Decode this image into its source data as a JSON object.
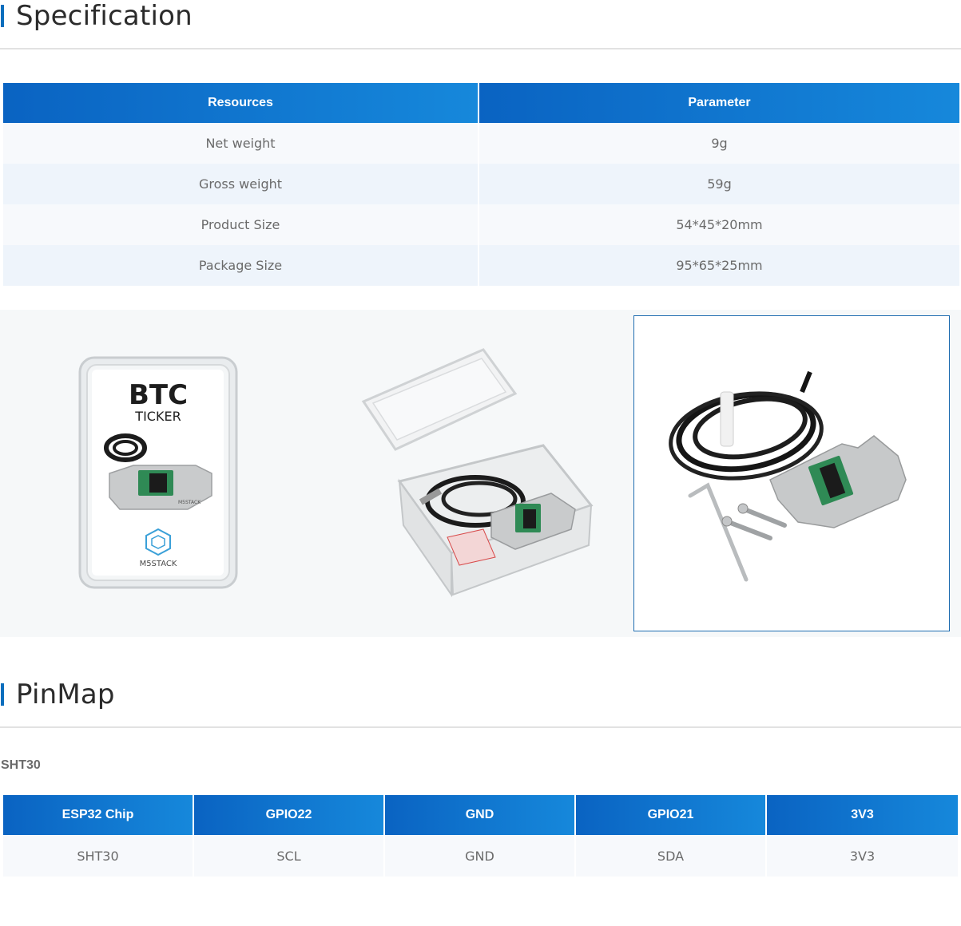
{
  "spec": {
    "title": "Specification",
    "headers": [
      "Resources",
      "Parameter"
    ],
    "rows": [
      {
        "resource": "Net weight",
        "parameter": "9g"
      },
      {
        "resource": "Gross weight",
        "parameter": "59g"
      },
      {
        "resource": "Product Size",
        "parameter": "54*45*20mm"
      },
      {
        "resource": "Package Size",
        "parameter": "95*65*25mm"
      }
    ]
  },
  "gallery": {
    "box_card": {
      "title": "BTC",
      "subtitle": "TICKER",
      "brand": "M5STACK",
      "stand_text": "M5STACK"
    }
  },
  "pinmap": {
    "title": "PinMap",
    "subtitle": "SHT30",
    "headers": [
      "ESP32 Chip",
      "GPIO22",
      "GND",
      "GPIO21",
      "3V3"
    ],
    "row": [
      "SHT30",
      "SCL",
      "GND",
      "SDA",
      "3V3"
    ]
  },
  "colors": {
    "accent": "#0a6ebd",
    "header_start": "#0a63c2",
    "header_end": "#1688db"
  }
}
